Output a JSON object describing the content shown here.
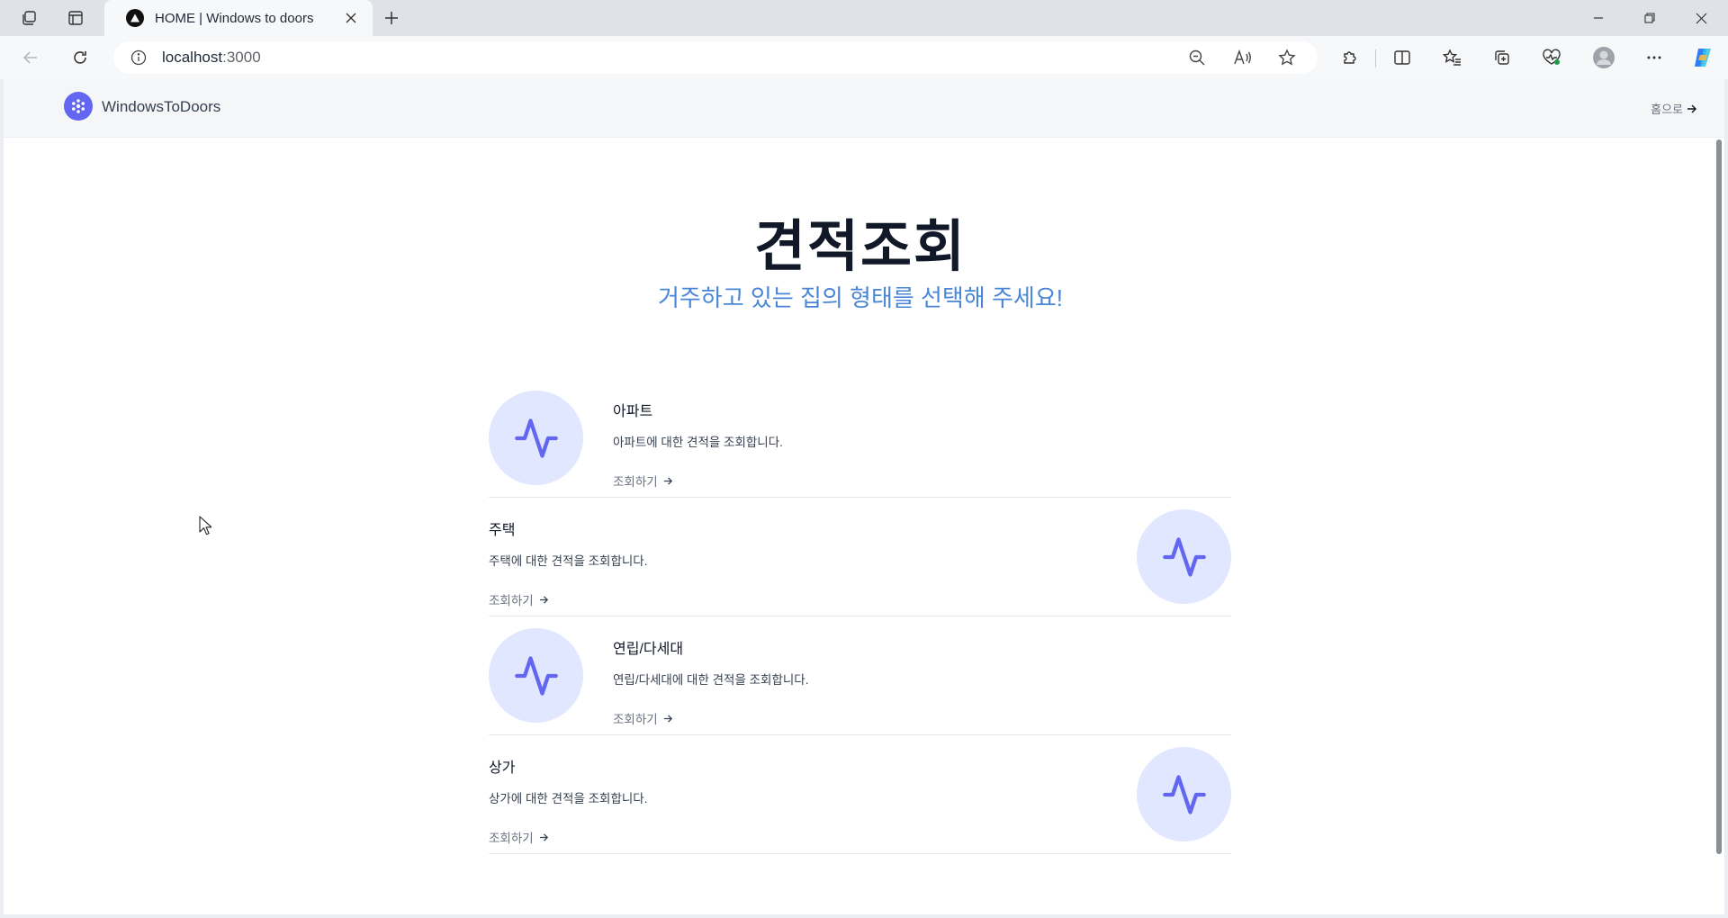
{
  "browser": {
    "tab_title": "HOME | Windows to doors",
    "url_host": "localhost",
    "url_port": ":3000"
  },
  "site": {
    "brand": "WindowsToDoors",
    "home_link": "홈으로"
  },
  "hero": {
    "title": "견적조회",
    "subtitle": "거주하고 있는 집의 형태를 선택해 주세요!"
  },
  "cards": [
    {
      "name": "아파트",
      "desc": "아파트에 대한 견적을 조회합니다.",
      "link": "조회하기",
      "icon": "activity-icon"
    },
    {
      "name": "주택",
      "desc": "주택에 대한 견적을 조회합니다.",
      "link": "조회하기",
      "icon": "activity-icon"
    },
    {
      "name": "연립/다세대",
      "desc": "연립/다세대에 대한 견적을 조회합니다.",
      "link": "조회하기",
      "icon": "activity-icon"
    },
    {
      "name": "상가",
      "desc": "상가에 대한 견적을 조회합니다.",
      "link": "조회하기",
      "icon": "activity-icon"
    }
  ],
  "colors": {
    "accent": "#6366f1",
    "icon_bg": "#e0e7ff",
    "subtitle": "#4a86d6"
  }
}
